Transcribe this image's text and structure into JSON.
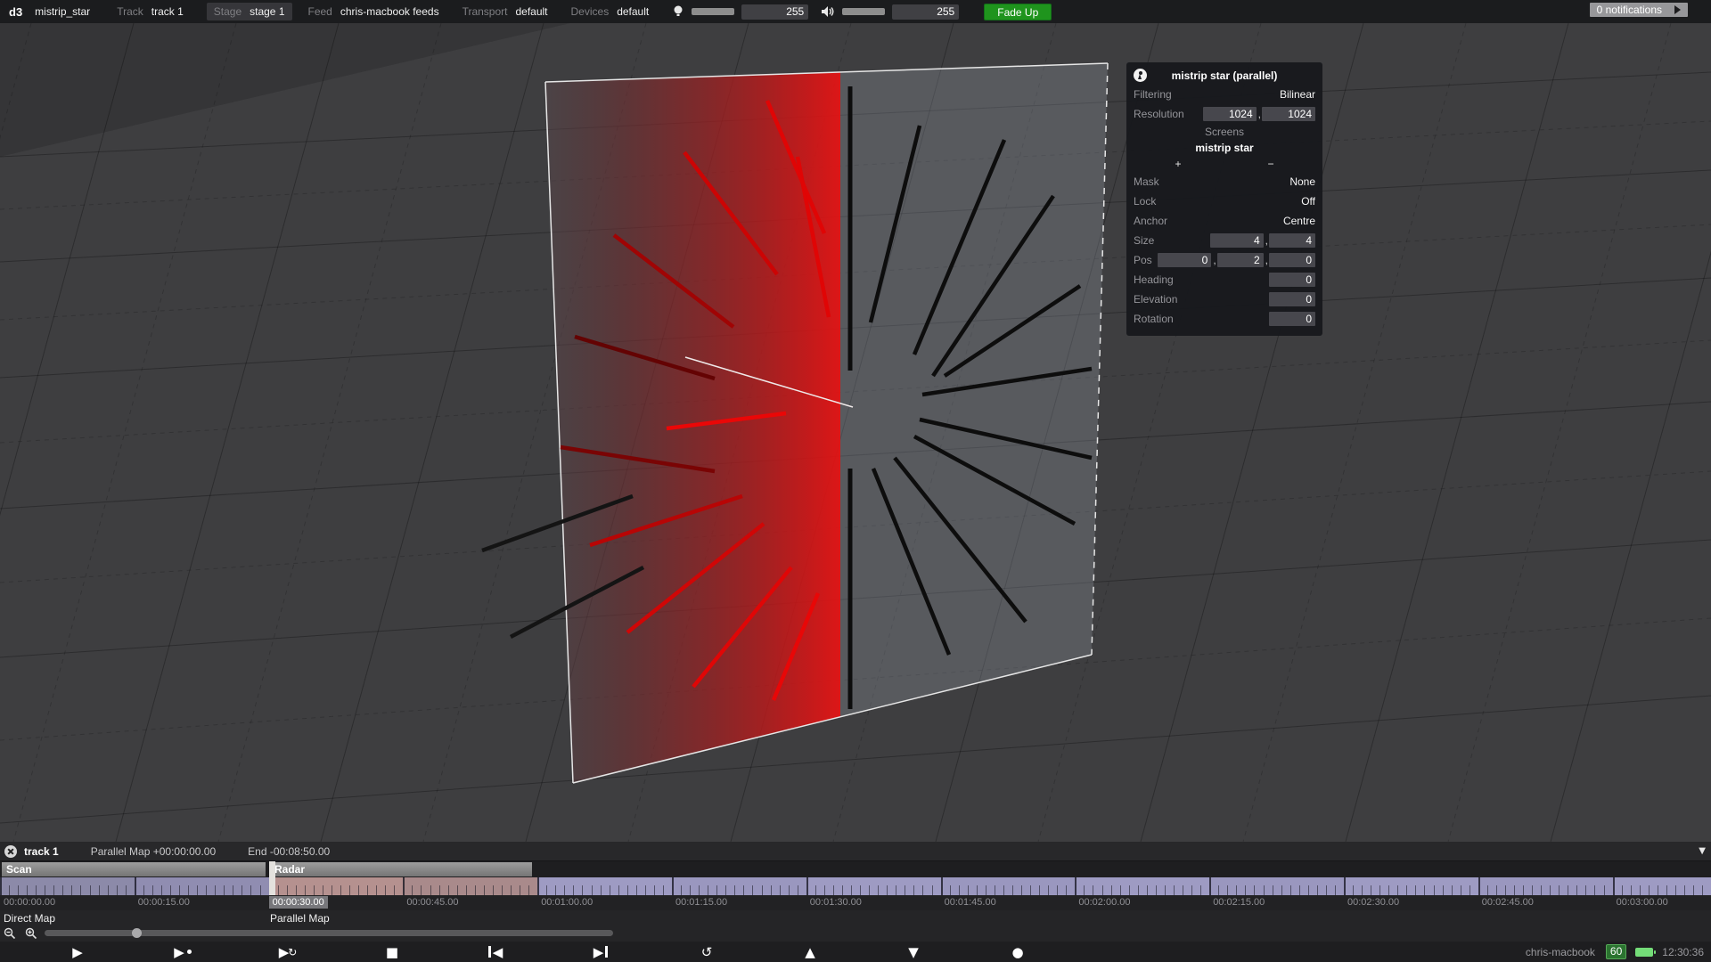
{
  "app": {
    "logo": "d3",
    "project": "mistrip_star"
  },
  "menubar": {
    "items": [
      {
        "label": "Track",
        "value": "track 1"
      },
      {
        "label": "Stage",
        "value": "stage 1"
      },
      {
        "label": "Feed",
        "value": "chris-macbook feeds"
      },
      {
        "label": "Transport",
        "value": "default"
      },
      {
        "label": "Devices",
        "value": "default"
      }
    ],
    "brightness_value": "255",
    "volume_value": "255",
    "fade_up_label": "Fade Up",
    "notifications_label": "0 notifications"
  },
  "inspector": {
    "title": "mistrip star (parallel)",
    "filtering_label": "Filtering",
    "filtering_value": "Bilinear",
    "resolution_label": "Resolution",
    "resolution_x": "1024",
    "resolution_y": "1024",
    "screens_header": "Screens",
    "screen_name": "mistrip star",
    "add_label": "+",
    "remove_label": "−",
    "mask_label": "Mask",
    "mask_value": "None",
    "lock_label": "Lock",
    "lock_value": "Off",
    "anchor_label": "Anchor",
    "anchor_value": "Centre",
    "size_label": "Size",
    "size_x": "4",
    "size_y": "4",
    "pos_label": "Pos",
    "pos_x": "0",
    "pos_y": "2",
    "pos_z": "0",
    "heading_label": "Heading",
    "heading_value": "0",
    "elevation_label": "Elevation",
    "elevation_value": "0",
    "rotation_label": "Rotation",
    "rotation_value": "0"
  },
  "timeline": {
    "track_name": "track 1",
    "position_text": "Parallel Map +00:00:00.00",
    "end_text": "End -00:08:50.00",
    "collapse_icon": "▼",
    "sections": [
      {
        "name": "Scan"
      },
      {
        "name": "Radar"
      }
    ],
    "ruler": {
      "segment_width": 150.8,
      "ticks_per_segment": 15,
      "highlight_index": 2,
      "labels": [
        "00:00:00.00",
        "00:00:15.00",
        "00:00:30.00",
        "00:00:45.00",
        "00:01:00.00",
        "00:01:15.00",
        "00:01:30.00",
        "00:01:45.00",
        "00:02:00.00",
        "00:02:15.00",
        "00:02:30.00",
        "00:02:45.00",
        "00:03:00.00"
      ],
      "segment_colors": [
        "#8c8aa9",
        "#908db1",
        "#b5918f",
        "#a98a8b",
        "#9e9bc3",
        "#9a97bf",
        "#9e9bc3",
        "#9a97bf",
        "#9e9bc3",
        "#9a97bf",
        "#9e9bc3",
        "#9a97bf",
        "#9e9bc3"
      ]
    },
    "map_labels": {
      "direct": "Direct Map",
      "parallel": "Parallel Map"
    }
  },
  "transport": {
    "buttons": [
      "play",
      "play-section",
      "loop-play",
      "stop",
      "previous-section",
      "next-section",
      "return-to-start",
      "arrow-up",
      "arrow-down",
      "record"
    ],
    "positions": [
      70,
      188,
      306,
      423,
      539,
      657,
      776,
      892,
      1008,
      1125
    ]
  },
  "statusbar": {
    "machine": "chris-macbook",
    "fps": "60",
    "clock": "12:30:36"
  },
  "colors": {
    "accent_green": "#1f941d",
    "screen_red": "#e01010",
    "spoke_black": "#0d0d0d"
  }
}
